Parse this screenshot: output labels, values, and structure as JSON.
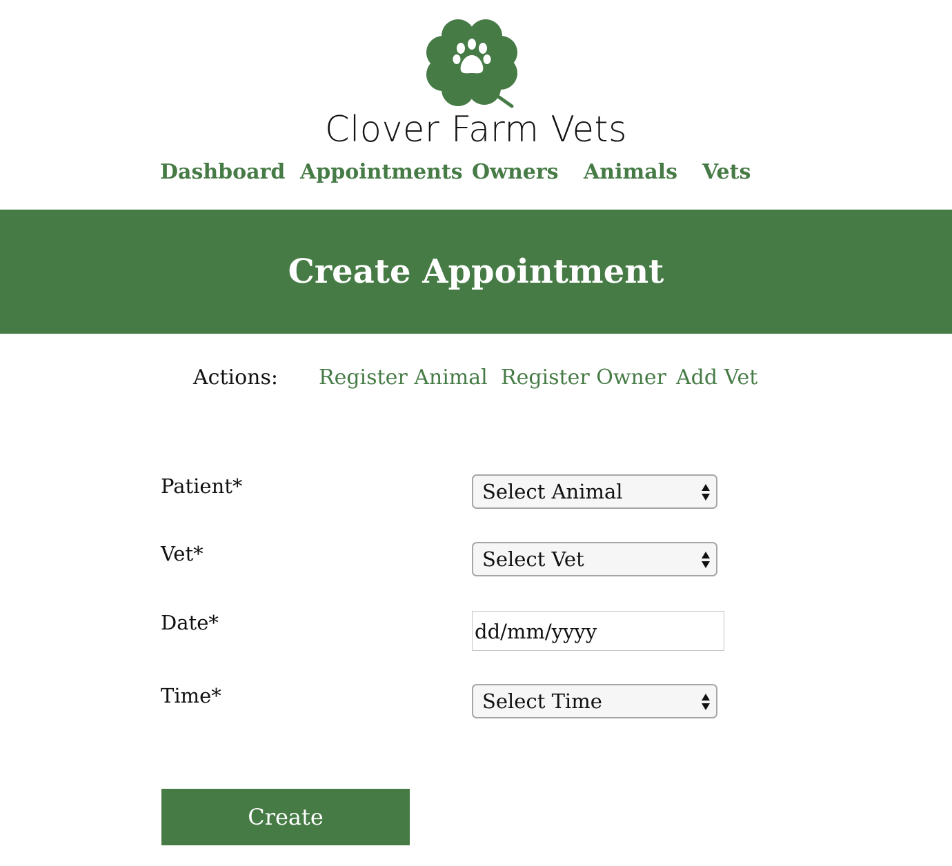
{
  "brand": {
    "name": "Clover Farm Vets",
    "logo_icon": "clover-paw-icon"
  },
  "colors": {
    "primary_green": "#467b46",
    "white": "#ffffff",
    "text": "#111111"
  },
  "nav": {
    "items": [
      {
        "label": "Dashboard"
      },
      {
        "label": "Appointments"
      },
      {
        "label": "Owners"
      },
      {
        "label": "Animals"
      },
      {
        "label": "Vets"
      }
    ]
  },
  "banner": {
    "title": "Create Appointment"
  },
  "actions": {
    "label": "Actions:",
    "links": [
      {
        "label": "Register Animal"
      },
      {
        "label": "Register Owner"
      },
      {
        "label": "Add Vet"
      }
    ]
  },
  "form": {
    "patient": {
      "label": "Patient*",
      "value": "Select Animal"
    },
    "vet": {
      "label": "Vet*",
      "value": "Select Vet"
    },
    "date": {
      "label": "Date*",
      "placeholder": "dd/mm/yyyy"
    },
    "time": {
      "label": "Time*",
      "value": "Select Time"
    },
    "submit_label": "Create"
  }
}
